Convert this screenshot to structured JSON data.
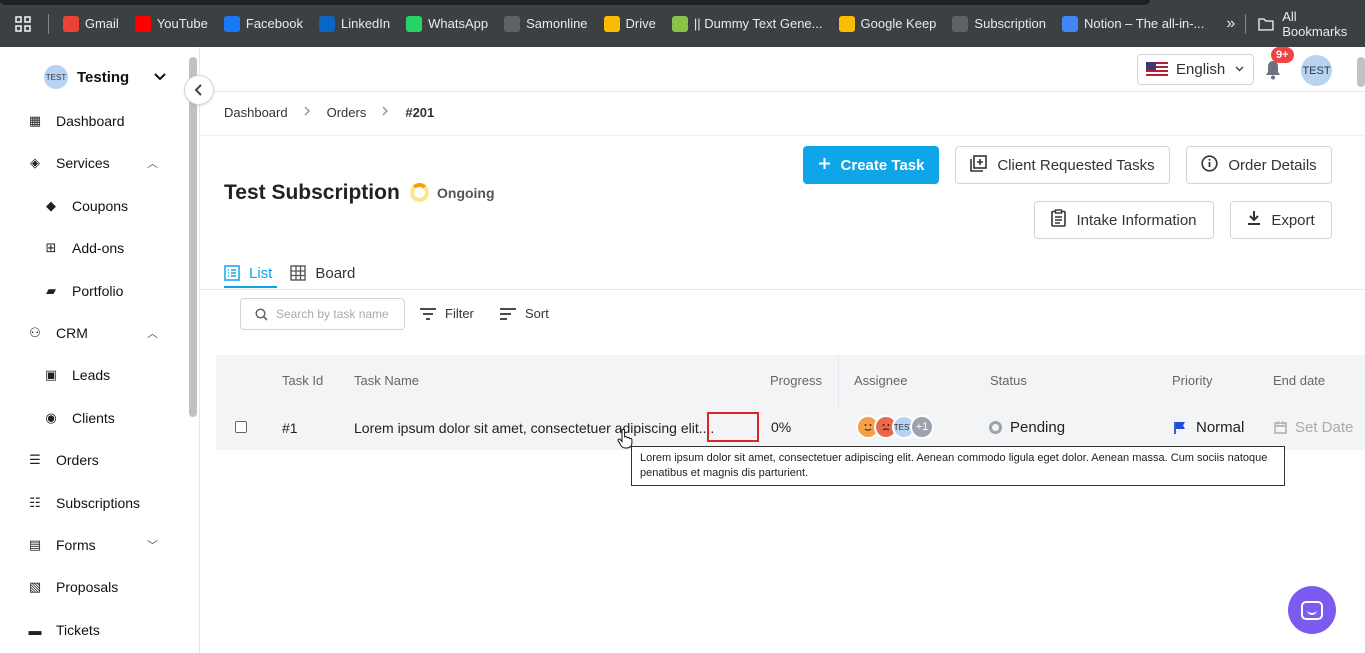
{
  "bookmarks": {
    "items": [
      {
        "label": "Gmail",
        "icon": "gmail-icon",
        "color": "#ea4335"
      },
      {
        "label": "YouTube",
        "icon": "youtube-icon",
        "color": "#ff0000"
      },
      {
        "label": "Facebook",
        "icon": "facebook-icon",
        "color": "#1877f2"
      },
      {
        "label": "LinkedIn",
        "icon": "linkedin-icon",
        "color": "#0a66c2"
      },
      {
        "label": "WhatsApp",
        "icon": "whatsapp-icon",
        "color": "#25d366"
      },
      {
        "label": "Samonline",
        "icon": "globe-icon",
        "color": "#5f6368"
      },
      {
        "label": "Drive",
        "icon": "drive-icon",
        "color": "#fbbc04"
      },
      {
        "label": "|| Dummy Text Gene...",
        "icon": "dummy-text-icon",
        "color": "#8bc34a"
      },
      {
        "label": "Google Keep",
        "icon": "keep-icon",
        "color": "#fbbc04"
      },
      {
        "label": "Subscription",
        "icon": "globe-icon",
        "color": "#5f6368"
      },
      {
        "label": "Notion – The all-in-...",
        "icon": "notion-icon",
        "color": "#4285f4"
      }
    ],
    "more": "»",
    "all_bookmarks": "All Bookmarks"
  },
  "sidebar": {
    "workspace": "Testing",
    "workspace_avatar": "TEST",
    "items": [
      {
        "label": "Dashboard",
        "icon": "▦",
        "top": 0
      },
      {
        "label": "Services",
        "icon": "◈",
        "caret": "︿"
      },
      {
        "label": "Coupons",
        "icon": "◆",
        "sub": true
      },
      {
        "label": "Add-ons",
        "icon": "⊞",
        "sub": true
      },
      {
        "label": "Portfolio",
        "icon": "▰",
        "sub": true
      },
      {
        "label": "CRM",
        "icon": "⚇",
        "caret": "︿"
      },
      {
        "label": "Leads",
        "icon": "▣",
        "sub": true
      },
      {
        "label": "Clients",
        "icon": "◉",
        "sub": true
      },
      {
        "label": "Orders",
        "icon": "☰"
      },
      {
        "label": "Subscriptions",
        "icon": "☷"
      },
      {
        "label": "Forms",
        "icon": "▤",
        "caret": "﹀"
      },
      {
        "label": "Proposals",
        "icon": "▧"
      },
      {
        "label": "Tickets",
        "icon": "▬"
      }
    ]
  },
  "topbar": {
    "language": "English",
    "notif_count": "9+",
    "user_avatar": "TEST"
  },
  "breadcrumb": [
    "Dashboard",
    "Orders",
    "#201"
  ],
  "page": {
    "title": "Test Subscription",
    "status": "Ongoing",
    "buttons": {
      "create_task": "Create Task",
      "client_requested": "Client Requested Tasks",
      "order_details": "Order Details",
      "intake": "Intake Information",
      "export": "Export"
    },
    "tabs": [
      "List",
      "Board"
    ]
  },
  "toolbar": {
    "search_placeholder": "Search by task name",
    "filter": "Filter",
    "sort": "Sort"
  },
  "table": {
    "headers": [
      "Task Id",
      "Task Name",
      "Progress",
      "Assignee",
      "Status",
      "Priority",
      "End date"
    ],
    "rows": [
      {
        "id": "#1",
        "name": "Lorem ipsum dolor sit amet, consectetuer adipiscing elit....",
        "progress": "0%",
        "assignee_extra": "+1",
        "assignee_avatar": "TEST",
        "status": "Pending",
        "priority": "Normal",
        "end_date": "Set Date"
      }
    ]
  },
  "tooltip": "Lorem ipsum dolor sit amet, consectetuer adipiscing elit. Aenean commodo ligula eget dolor. Aenean massa. Cum sociis natoque penatibus et magnis dis parturient.",
  "colors": {
    "accent": "#0ea5e9",
    "highlight": "#dc2626",
    "chat": "#7c5cf0"
  }
}
